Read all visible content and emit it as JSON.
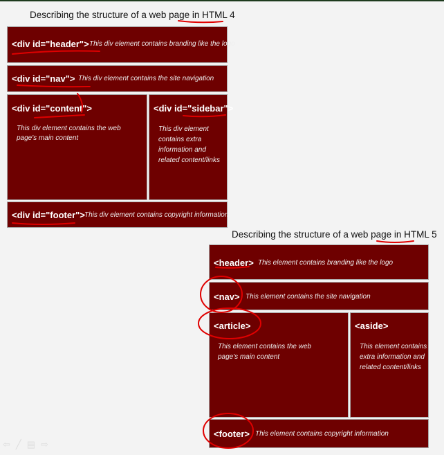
{
  "html4": {
    "title_prefix": "Describing the structure of a web page in ",
    "title_emph": "HTML 4",
    "header": {
      "tag": "<div id=\"header\">",
      "desc": "This div element contains branding like the logo"
    },
    "nav": {
      "tag": "<div id=\"nav\">",
      "desc": "This div element contains the site navigation"
    },
    "content": {
      "tag": "<div id=\"content\">",
      "desc": "This div element contains the web page's main content"
    },
    "sidebar": {
      "tag": "<div id=\"sidebar\">",
      "desc": "This div element contains extra information and related content/links"
    },
    "footer": {
      "tag": "<div id=\"footer\">",
      "desc": "This div element contains copyright information"
    }
  },
  "html5": {
    "title_prefix": "Describing the structure of a web page in ",
    "title_emph": "HTML 5",
    "header": {
      "tag": "<header>",
      "desc": "This element contains branding like the logo"
    },
    "nav": {
      "tag": "<nav>",
      "desc": "This element contains the site navigation"
    },
    "article": {
      "tag": "<article>",
      "desc": "This element contains the web page's main content"
    },
    "aside": {
      "tag": "<aside>",
      "desc": "This element contains extra information and related content/links"
    },
    "footer": {
      "tag": "<footer>",
      "desc": "This element contains copyright information"
    }
  },
  "colors": {
    "box": "#6e0000",
    "ink": "#e00000"
  }
}
